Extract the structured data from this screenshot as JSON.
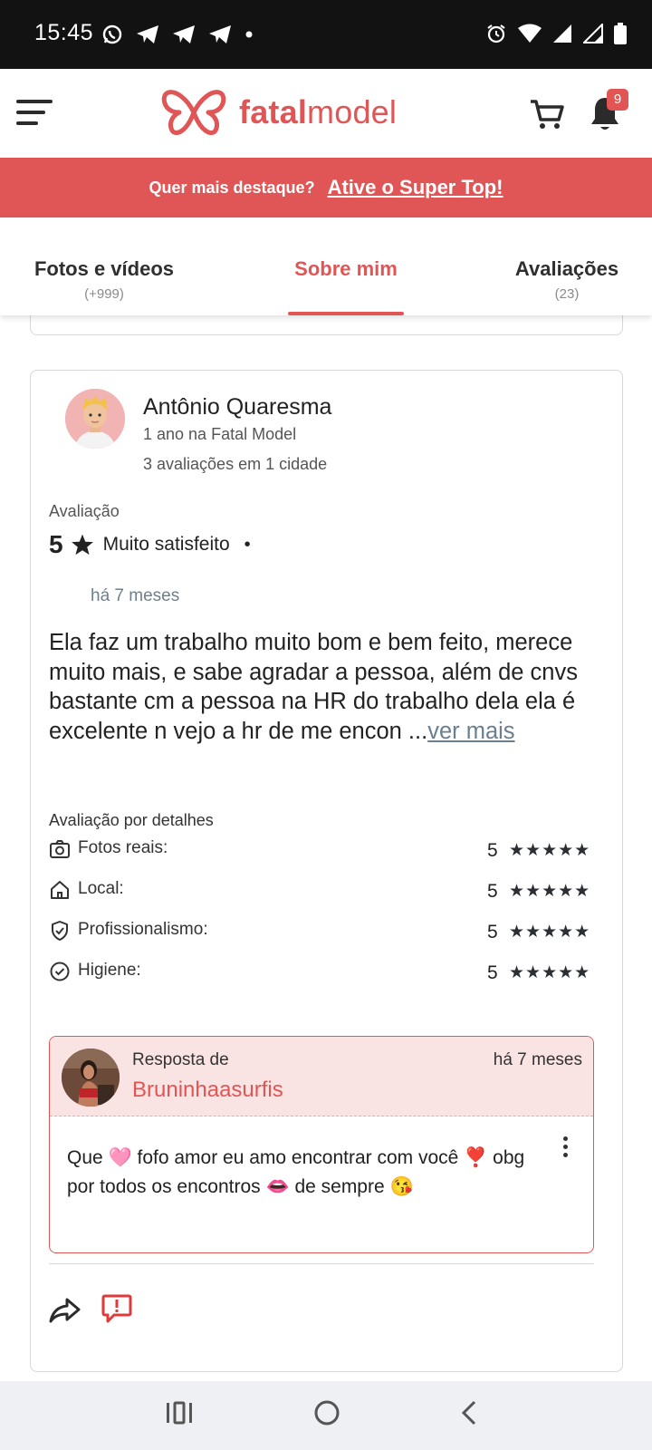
{
  "status_bar": {
    "time": "15:45"
  },
  "header": {
    "logo_prefix": "fatal",
    "logo_suffix": "model",
    "notification_count": "9"
  },
  "promo": {
    "text": "Quer mais destaque?",
    "link": "Ative o Super Top!"
  },
  "tabs": [
    {
      "label": "Fotos e vídeos",
      "count": "(+999)"
    },
    {
      "label": "Sobre mim",
      "count": ""
    },
    {
      "label": "Avaliações",
      "count": "(23)"
    }
  ],
  "review": {
    "reviewer_name": "Antônio Quaresma",
    "reviewer_since": "1 ano na Fatal Model",
    "reviewer_reviews": "3 avaliações em 1 cidade",
    "rating_label": "Avaliação",
    "rating_score": "5",
    "rating_text": "Muito satisfeito",
    "rating_separator": "•",
    "date": "há 7 meses",
    "body": "Ela faz um trabalho muito bom e bem feito, merece muito mais, e sabe agradar a pessoa, além de cnvs bastante cm a pessoa na HR do trabalho dela ela é excelente n vejo a hr de me encon ...",
    "more_link": "ver mais",
    "details_title": "Avaliação por detalhes",
    "details": [
      {
        "icon": "camera-icon",
        "label": "Fotos reais:",
        "score": "5",
        "stars": "★★★★★"
      },
      {
        "icon": "home-icon",
        "label": "Local:",
        "score": "5",
        "stars": "★★★★★"
      },
      {
        "icon": "shield-check-icon",
        "label": "Profissionalismo:",
        "score": "5",
        "stars": "★★★★★"
      },
      {
        "icon": "check-circle-icon",
        "label": "Higiene:",
        "score": "5",
        "stars": "★★★★★"
      }
    ],
    "reply": {
      "label": "Resposta de",
      "author": "Bruninhaasurfis",
      "date": "há 7 meses",
      "body": "Que 🩷 fofo amor eu amo encontrar com você ❣️ obg por todos os encontros 👄 de sempre 😘"
    }
  }
}
